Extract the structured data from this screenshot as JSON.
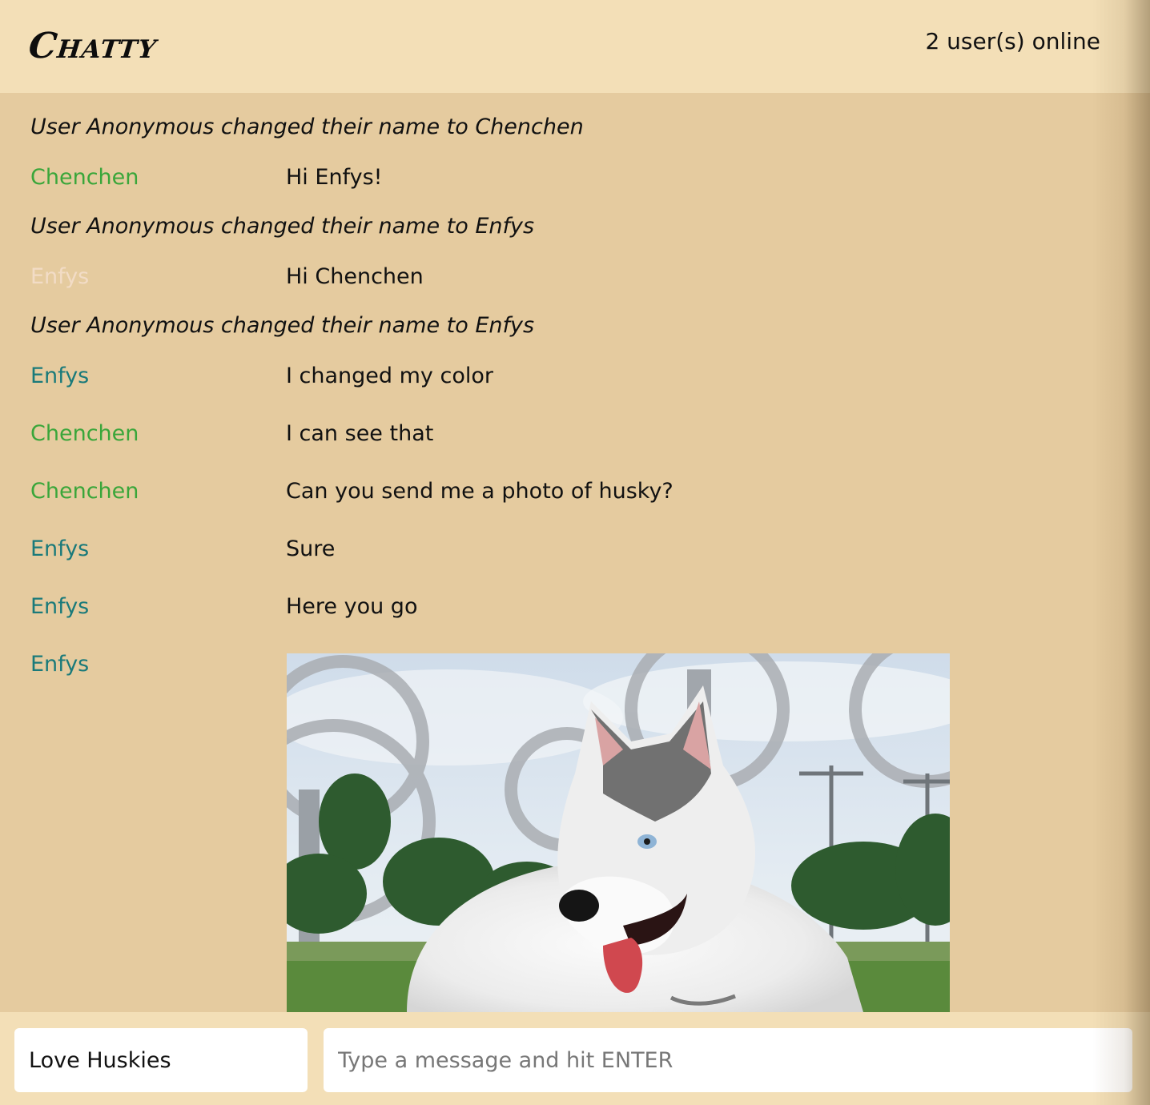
{
  "header": {
    "brand": "Chatty",
    "online_status": "2 user(s) online"
  },
  "colors": {
    "header_bg": "#f3dfb7",
    "chat_bg": "#e5cb9f",
    "user_green": "#3aa63a",
    "user_teal": "#1a7a7a",
    "user_faint": "#f2dcc6"
  },
  "messages": [
    {
      "type": "system",
      "text": "User Anonymous changed their name to Chenchen"
    },
    {
      "type": "message",
      "user": "Chenchen",
      "text": "Hi Enfys!"
    },
    {
      "type": "system",
      "text": "User Anonymous changed their name to Enfys"
    },
    {
      "type": "message",
      "user": "Enfys",
      "text": "Hi Chenchen"
    },
    {
      "type": "system",
      "text": "User Anonymous changed their name to Enfys"
    },
    {
      "type": "message",
      "user": "Enfys",
      "text": "I changed my color"
    },
    {
      "type": "message",
      "user": "Chenchen",
      "text": "I can see that"
    },
    {
      "type": "message",
      "user": "Chenchen",
      "text": "Can you send me a photo of husky?"
    },
    {
      "type": "message",
      "user": "Enfys",
      "text": "Sure"
    },
    {
      "type": "message",
      "user": "Enfys",
      "text": "Here you go"
    },
    {
      "type": "image",
      "user": "Enfys",
      "image": "husky-photo"
    }
  ],
  "composer": {
    "username_value": "Love Huskies",
    "message_placeholder": "Type a message and hit ENTER",
    "message_value": ""
  }
}
